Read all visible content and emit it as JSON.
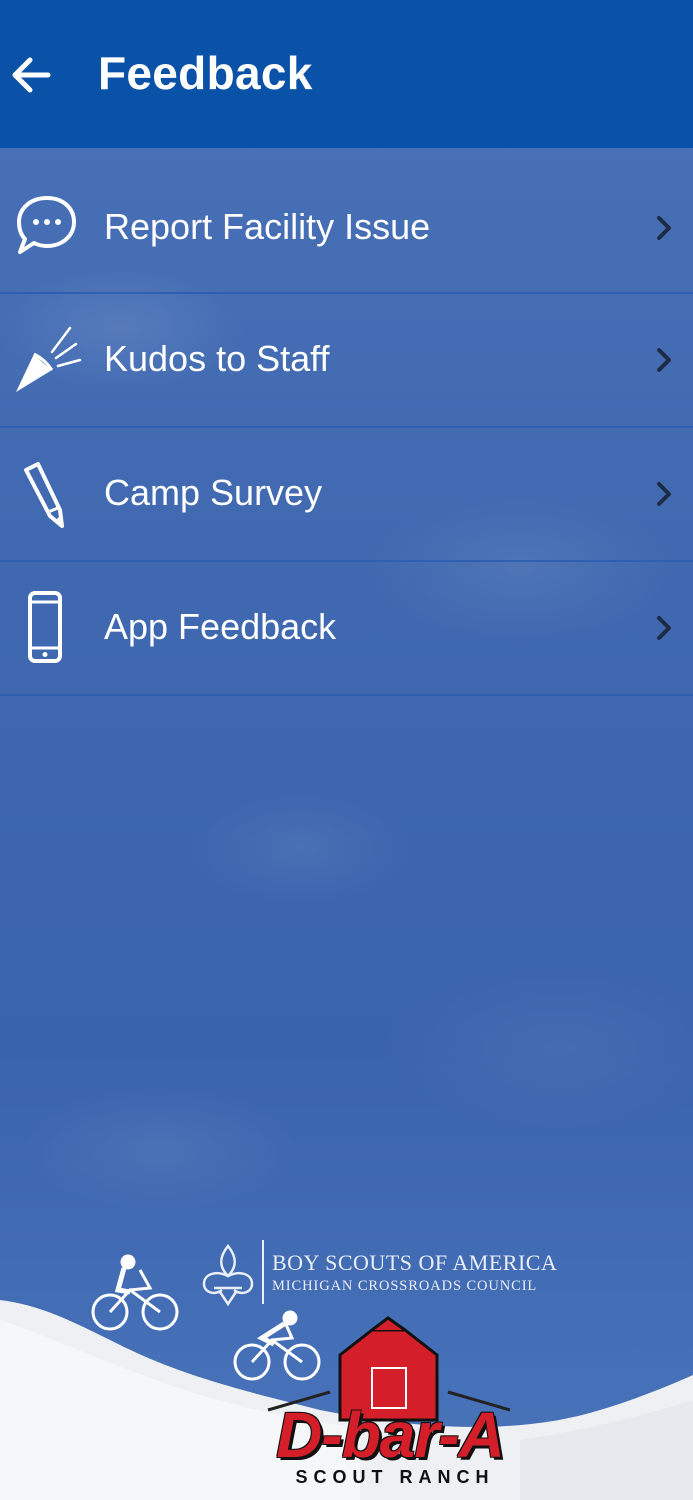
{
  "appbar": {
    "title": "Feedback",
    "back_icon": "arrow-left-icon",
    "background": "#0a52a8"
  },
  "menu": [
    {
      "label": "Report Facility Issue",
      "icon": "chat-bubble-icon"
    },
    {
      "label": "Kudos to Staff",
      "icon": "megaphone-icon"
    },
    {
      "label": "Camp Survey",
      "icon": "pencil-icon"
    },
    {
      "label": "App Feedback",
      "icon": "phone-icon"
    }
  ],
  "footer": {
    "bsa_line1": "BOY SCOUTS OF AMERICA",
    "bsa_line2": "MICHIGAN CROSSROADS COUNCIL",
    "brand_name": "D-bar-A",
    "brand_sub": "SCOUT RANCH",
    "brand_color": "#d41f2a"
  }
}
